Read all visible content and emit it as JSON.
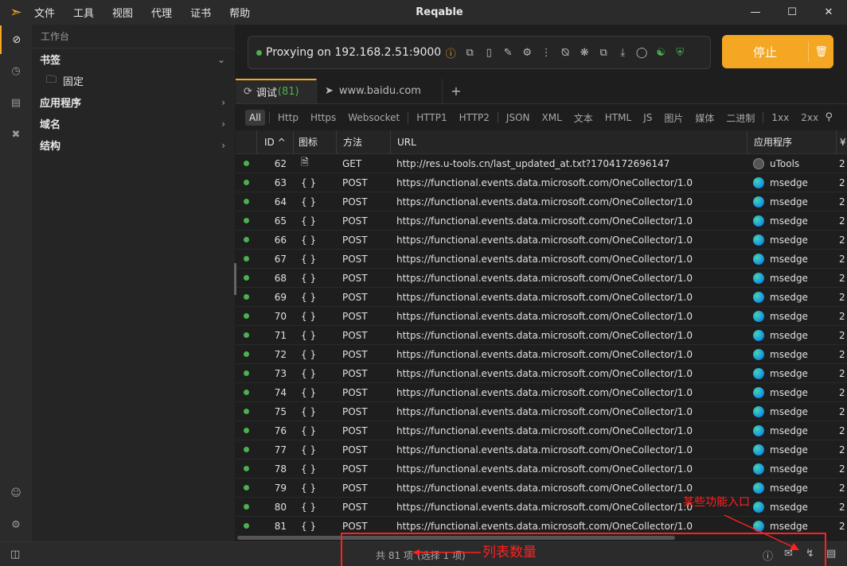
{
  "titlebar": {
    "title": "Reqable",
    "menu": [
      "文件",
      "工具",
      "视图",
      "代理",
      "证书",
      "帮助"
    ]
  },
  "sidebar": {
    "title": "工作台",
    "sections": [
      {
        "label": "书签",
        "expanded": true
      },
      {
        "label": "固定",
        "sub": true
      },
      {
        "label": "应用程序",
        "expanded": false
      },
      {
        "label": "域名",
        "expanded": false
      },
      {
        "label": "结构",
        "expanded": false
      }
    ]
  },
  "proxy": {
    "status_text": "Proxying on 192.168.2.51:9000",
    "stop_label": "停止"
  },
  "tabs": [
    {
      "label": "调试",
      "count": "(81)",
      "active": true
    },
    {
      "label": "www.baidu.com",
      "active": false
    }
  ],
  "filters": [
    "All",
    "Http",
    "Https",
    "Websocket",
    "HTTP1",
    "HTTP2",
    "JSON",
    "XML",
    "文本",
    "HTML",
    "JS",
    "图片",
    "媒体",
    "二进制",
    "1xx",
    "2xx"
  ],
  "table": {
    "headers": {
      "id": "ID ^",
      "icon": "图标",
      "method": "方法",
      "url": "URL",
      "app": "应用程序",
      "extra": "¥"
    },
    "rows": [
      {
        "id": "62",
        "icon": "file",
        "method": "GET",
        "url": "http://res.u-tools.cn/last_updated_at.txt?1704172696147",
        "app": "uTools",
        "extra": "2"
      },
      {
        "id": "63",
        "icon": "{ }",
        "method": "POST",
        "url": "https://functional.events.data.microsoft.com/OneCollector/1.0",
        "app": "msedge",
        "extra": "2"
      },
      {
        "id": "64",
        "icon": "{ }",
        "method": "POST",
        "url": "https://functional.events.data.microsoft.com/OneCollector/1.0",
        "app": "msedge",
        "extra": "2"
      },
      {
        "id": "65",
        "icon": "{ }",
        "method": "POST",
        "url": "https://functional.events.data.microsoft.com/OneCollector/1.0",
        "app": "msedge",
        "extra": "2"
      },
      {
        "id": "66",
        "icon": "{ }",
        "method": "POST",
        "url": "https://functional.events.data.microsoft.com/OneCollector/1.0",
        "app": "msedge",
        "extra": "2"
      },
      {
        "id": "67",
        "icon": "{ }",
        "method": "POST",
        "url": "https://functional.events.data.microsoft.com/OneCollector/1.0",
        "app": "msedge",
        "extra": "2"
      },
      {
        "id": "68",
        "icon": "{ }",
        "method": "POST",
        "url": "https://functional.events.data.microsoft.com/OneCollector/1.0",
        "app": "msedge",
        "extra": "2"
      },
      {
        "id": "69",
        "icon": "{ }",
        "method": "POST",
        "url": "https://functional.events.data.microsoft.com/OneCollector/1.0",
        "app": "msedge",
        "extra": "2"
      },
      {
        "id": "70",
        "icon": "{ }",
        "method": "POST",
        "url": "https://functional.events.data.microsoft.com/OneCollector/1.0",
        "app": "msedge",
        "extra": "2"
      },
      {
        "id": "71",
        "icon": "{ }",
        "method": "POST",
        "url": "https://functional.events.data.microsoft.com/OneCollector/1.0",
        "app": "msedge",
        "extra": "2"
      },
      {
        "id": "72",
        "icon": "{ }",
        "method": "POST",
        "url": "https://functional.events.data.microsoft.com/OneCollector/1.0",
        "app": "msedge",
        "extra": "2"
      },
      {
        "id": "73",
        "icon": "{ }",
        "method": "POST",
        "url": "https://functional.events.data.microsoft.com/OneCollector/1.0",
        "app": "msedge",
        "extra": "2"
      },
      {
        "id": "74",
        "icon": "{ }",
        "method": "POST",
        "url": "https://functional.events.data.microsoft.com/OneCollector/1.0",
        "app": "msedge",
        "extra": "2"
      },
      {
        "id": "75",
        "icon": "{ }",
        "method": "POST",
        "url": "https://functional.events.data.microsoft.com/OneCollector/1.0",
        "app": "msedge",
        "extra": "2"
      },
      {
        "id": "76",
        "icon": "{ }",
        "method": "POST",
        "url": "https://functional.events.data.microsoft.com/OneCollector/1.0",
        "app": "msedge",
        "extra": "2"
      },
      {
        "id": "77",
        "icon": "{ }",
        "method": "POST",
        "url": "https://functional.events.data.microsoft.com/OneCollector/1.0",
        "app": "msedge",
        "extra": "2"
      },
      {
        "id": "78",
        "icon": "{ }",
        "method": "POST",
        "url": "https://functional.events.data.microsoft.com/OneCollector/1.0",
        "app": "msedge",
        "extra": "2"
      },
      {
        "id": "79",
        "icon": "{ }",
        "method": "POST",
        "url": "https://functional.events.data.microsoft.com/OneCollector/1.0",
        "app": "msedge",
        "extra": "2"
      },
      {
        "id": "80",
        "icon": "{ }",
        "method": "POST",
        "url": "https://functional.events.data.microsoft.com/OneCollector/1.0",
        "app": "msedge",
        "extra": "2"
      },
      {
        "id": "81",
        "icon": "{ }",
        "method": "POST",
        "url": "https://functional.events.data.microsoft.com/OneCollector/1.0",
        "app": "msedge",
        "extra": "2"
      }
    ]
  },
  "statusbar": {
    "count_text": "共 81 项",
    "selected_text": "(选择 1 项)"
  },
  "annotations": {
    "list_count": "列表数量",
    "feature_entry": "某些功能入口"
  },
  "colors": {
    "accent": "#f5a623",
    "status_green": "#4caf50",
    "annotation_red": "#ff2020"
  }
}
